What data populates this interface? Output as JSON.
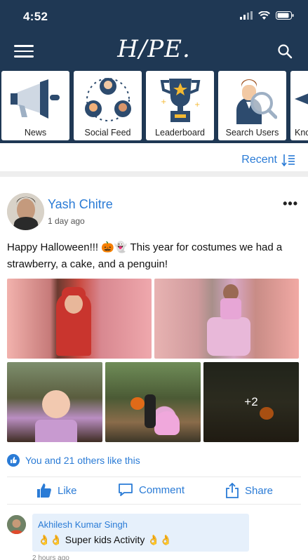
{
  "status_bar": {
    "time": "4:52"
  },
  "header": {
    "logo_text": "H/PE."
  },
  "nav": {
    "tiles": [
      {
        "label": "News",
        "icon": "megaphone-icon"
      },
      {
        "label": "Social Feed",
        "icon": "people-network-icon"
      },
      {
        "label": "Leaderboard",
        "icon": "trophy-icon"
      },
      {
        "label": "Search Users",
        "icon": "search-user-icon"
      },
      {
        "label": "Kno",
        "icon": "graduation-cap-icon"
      }
    ]
  },
  "filter": {
    "label": "Recent",
    "icon": "sort-icon"
  },
  "post": {
    "author": "Yash Chitre",
    "time": "1 day ago",
    "text": "Happy Halloween!!! 🎃👻 This year for costumes  we had a strawberry, a cake, and a penguin!",
    "more_images_label": "+2",
    "likes_text": "You and 21 others like this",
    "actions": {
      "like": "Like",
      "comment": "Comment",
      "share": "Share"
    },
    "comment": {
      "author": "Akhilesh Kumar Singh",
      "text": "👌👌 Super kids Activity 👌👌",
      "time": "2 hours ago"
    }
  },
  "colors": {
    "header_bg": "#1f3854",
    "accent": "#2a7bd6",
    "comment_bg": "#e6f0fb"
  }
}
